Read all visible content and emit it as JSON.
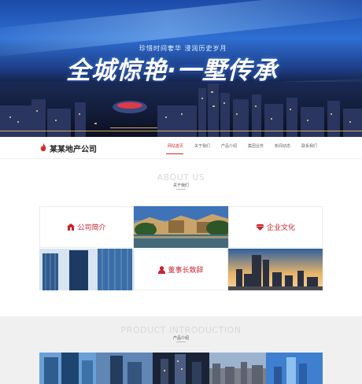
{
  "hero": {
    "tagline": "珍惜时间奢华  浸润历史岁月",
    "headline": "全城惊艳·一墅传承"
  },
  "nav": {
    "logo_text": "某某地产公司",
    "items": [
      "网站首页",
      "关于我们",
      "产品介绍",
      "集团业务",
      "新闻动态",
      "联系我们"
    ],
    "active_index": 0
  },
  "about": {
    "title_en": "ABOUT US",
    "title_cn": "关于我们",
    "cells": {
      "company_intro": "公司简介",
      "culture": "企业文化",
      "chairman": "董事长致辞"
    }
  },
  "product": {
    "title_en": "PRODUCT INTRODUCTION",
    "title_cn": "产品介绍"
  },
  "colors": {
    "accent": "#c8232c",
    "hero_top": "#2f6fd2",
    "hero_bottom": "#0f1426"
  }
}
